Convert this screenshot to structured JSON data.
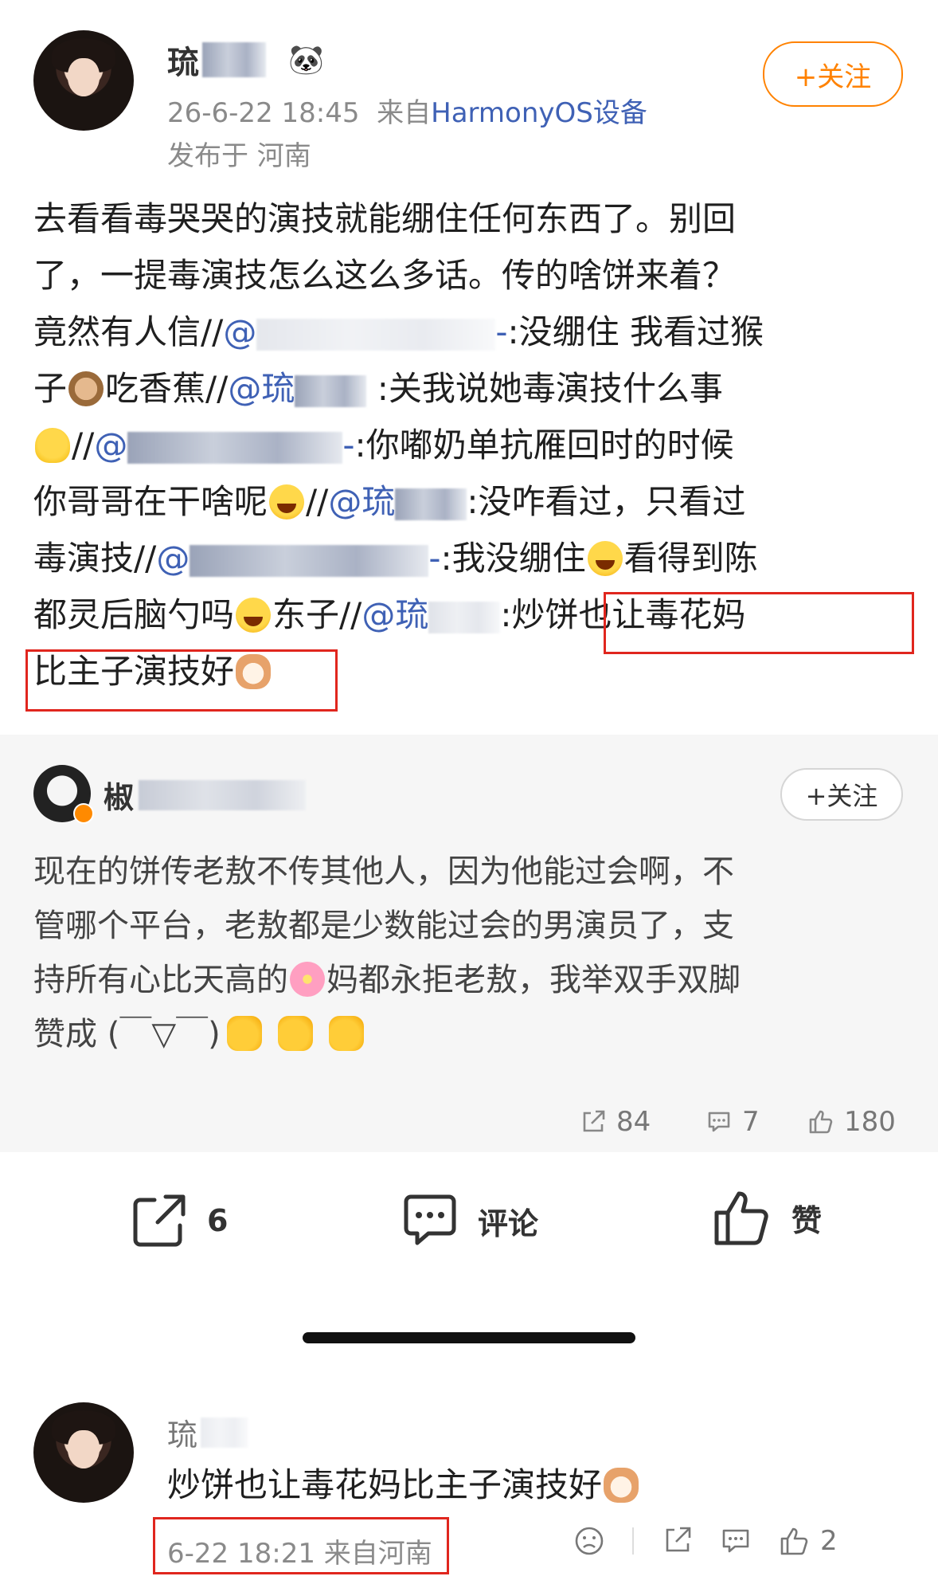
{
  "post": {
    "author_prefix": "琉",
    "badge_icon": "panda-icon",
    "time": "26-6-22 18:45",
    "from_prefix": "来自",
    "device": "HarmonyOS设备",
    "location": "发布于 河南",
    "follow_label": "+关注",
    "body": {
      "line1": "去看看毒哭哭的演技就能绷住任何东西了。别回",
      "line2": "了，一提毒演技怎么这么多话。传的啥饼来着？",
      "line3a": "竟然有人信//",
      "mention_at": "@",
      "line3b_tail": "-",
      "line3b": ":没绷住 我看过猴",
      "line4a": "子",
      "line4b": "吃香蕉//",
      "mention2": "@琉",
      "line4c": ":关我说她毒演技什么事",
      "line5a": "//",
      "line5b": "@",
      "line5c": "-",
      "line5d": ":你嘟奶单抗雁回时的时候",
      "line6a": "你哥哥在干啥呢",
      "line6b": "//",
      "mention3": "@琉",
      "line6c": ":没咋看过，只看过",
      "line7a": "毒演技//",
      "line7b": "@",
      "line7c": "-",
      "line7d": ":我没绷住",
      "line7e": "看得到陈",
      "line8a": "都灵后脑勺吗",
      "line8b": "东子//",
      "mention4": "@琉",
      "line8c": ":炒饼也让毒花妈",
      "line9": "比主子演技好"
    }
  },
  "repost": {
    "author_prefix": "椒",
    "follow_label": "+关注",
    "line1": "现在的饼传老敖不传其他人，因为他能过会啊，不",
    "line2": "管哪个平台，老敖都是少数能过会的男演员了，支",
    "line3a": "持所有心比天高的",
    "line3b": "妈都永拒老敖，我举双手双脚",
    "line4": "赞成 (￣▽￣)",
    "stats": {
      "share": "84",
      "comment": "7",
      "like": "180"
    }
  },
  "actions": {
    "share_count": "6",
    "comment_label": "评论",
    "like_label": "赞"
  },
  "comment": {
    "author_prefix": "琉",
    "text": "炒饼也让毒花妈比主子演技好",
    "meta": "6-22 18:21 来自河南",
    "like_count": "2"
  }
}
